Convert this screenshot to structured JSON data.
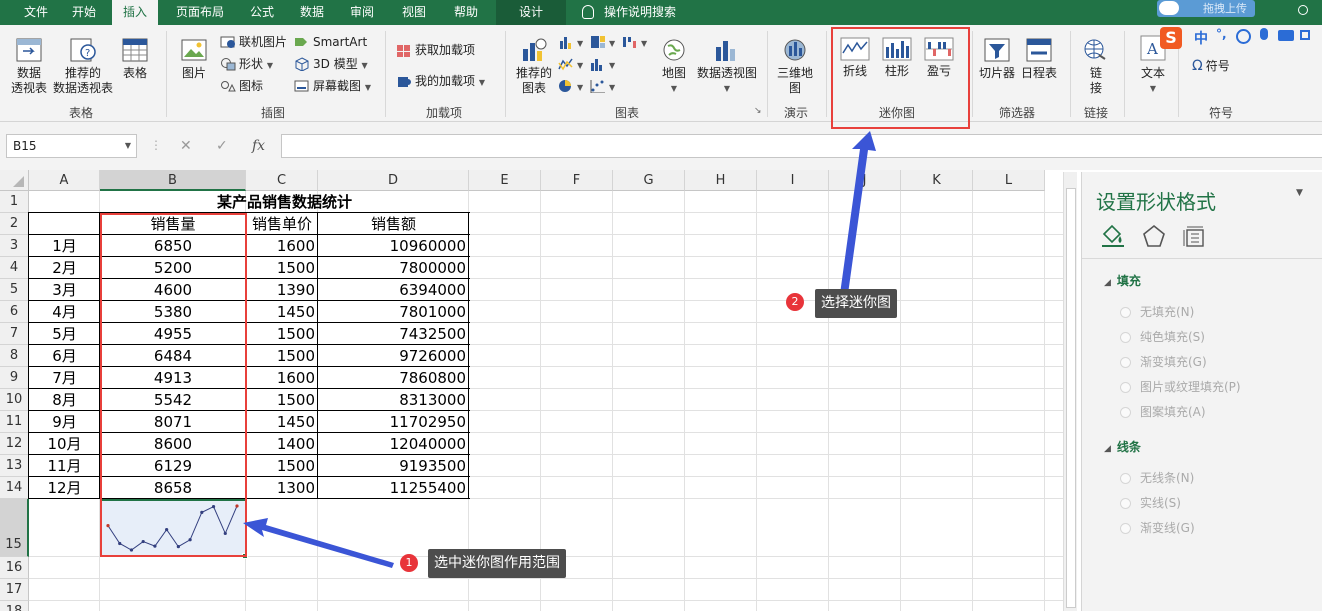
{
  "ribbon_tabs": [
    "文件",
    "开始",
    "插入",
    "页面布局",
    "公式",
    "数据",
    "审阅",
    "视图",
    "帮助"
  ],
  "context_tab": "设计",
  "tell_me": "操作说明搜索",
  "upload_label": "拖拽上传",
  "ribbon": {
    "tables": {
      "pivot_l1": "数据",
      "pivot_l2": "透视表",
      "rec_pivot_l1": "推荐的",
      "rec_pivot_l2": "数据透视表",
      "table": "表格",
      "group": "表格"
    },
    "illustrations": {
      "pictures": "图片",
      "online_pictures": "联机图片",
      "shapes": "形状",
      "icons": "图标",
      "smartart": "SmartArt",
      "model3d": "3D 模型",
      "screenshot": "屏幕截图",
      "group": "插图"
    },
    "addins": {
      "get": "获取加载项",
      "mine": "我的加载项",
      "group": "加载项"
    },
    "charts": {
      "rec_l1": "推荐的",
      "rec_l2": "图表",
      "map": "地图",
      "pivot_chart": "数据透视图",
      "group": "图表"
    },
    "tours": {
      "map3d_l1": "三维地",
      "map3d_l2": "图",
      "group": "演示"
    },
    "sparklines": {
      "line": "折线",
      "column": "柱形",
      "winloss": "盈亏",
      "group": "迷你图"
    },
    "filters": {
      "slicer": "切片器",
      "timeline": "日程表",
      "group": "筛选器"
    },
    "links": {
      "link_l1": "链",
      "link_l2": "接",
      "group": "链接"
    },
    "text": {
      "text": "文本"
    },
    "symbols": {
      "symbol": "符号",
      "group": "符号"
    }
  },
  "ime_toolbar": {
    "logo": "S",
    "lang": "中",
    "punct": "°,"
  },
  "formula_bar": {
    "name_box": "B15",
    "formula": ""
  },
  "sheet": {
    "columns": [
      "A",
      "B",
      "C",
      "D",
      "E",
      "F",
      "G",
      "H",
      "I",
      "J",
      "K",
      "L"
    ],
    "rows": [
      "1",
      "2",
      "3",
      "4",
      "5",
      "6",
      "7",
      "8",
      "9",
      "10",
      "11",
      "12",
      "13",
      "14",
      "15",
      "16",
      "17",
      "18"
    ],
    "title": "某产品销售数据统计",
    "headers": [
      "",
      "销售量",
      "销售单价",
      "销售额"
    ],
    "data": [
      [
        "1月",
        "6850",
        "1600",
        "10960000"
      ],
      [
        "2月",
        "5200",
        "1500",
        "7800000"
      ],
      [
        "3月",
        "4600",
        "1390",
        "6394000"
      ],
      [
        "4月",
        "5380",
        "1450",
        "7801000"
      ],
      [
        "5月",
        "4955",
        "1500",
        "7432500"
      ],
      [
        "6月",
        "6484",
        "1500",
        "9726000"
      ],
      [
        "7月",
        "4913",
        "1600",
        "7860800"
      ],
      [
        "8月",
        "5542",
        "1500",
        "8313000"
      ],
      [
        "9月",
        "8071",
        "1450",
        "11702950"
      ],
      [
        "10月",
        "8600",
        "1400",
        "12040000"
      ],
      [
        "11月",
        "6129",
        "1500",
        "9193500"
      ],
      [
        "12月",
        "8658",
        "1300",
        "11255400"
      ]
    ]
  },
  "sparkline_values": [
    6850,
    5200,
    4600,
    5380,
    4955,
    6484,
    4913,
    5542,
    8071,
    8600,
    6129,
    8658
  ],
  "format_pane": {
    "title": "设置形状格式",
    "fill_section": "填充",
    "fill_options": [
      "无填充(N)",
      "纯色填充(S)",
      "渐变填充(G)",
      "图片或纹理填充(P)",
      "图案填充(A)"
    ],
    "line_section": "线条",
    "line_options": [
      "无线条(N)",
      "实线(S)",
      "渐变线(G)"
    ]
  },
  "annotations": {
    "step1": {
      "num": "1",
      "text": "选中迷你图作用范围"
    },
    "step2": {
      "num": "2",
      "text": "选择迷你图"
    }
  },
  "colors": {
    "accent": "#217346",
    "annotation_red": "#e8403b",
    "arrow_blue": "#3b55d6",
    "sparkline": "#333f7f"
  }
}
